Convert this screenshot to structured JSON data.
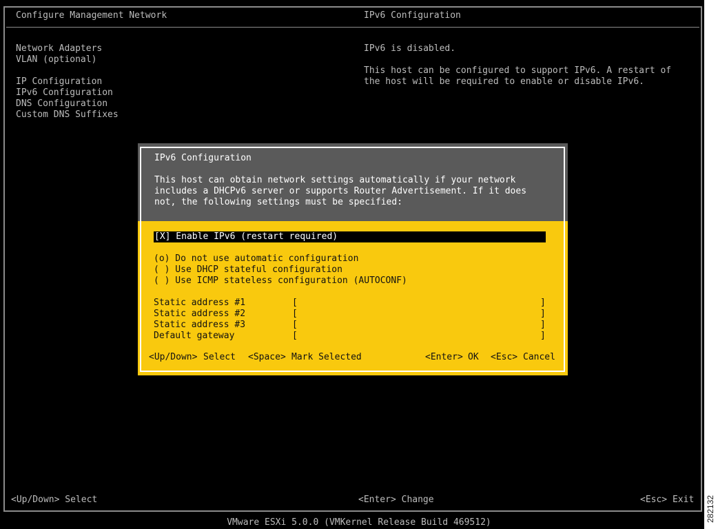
{
  "header": {
    "left_title": "Configure Management Network",
    "right_title": "IPv6 Configuration"
  },
  "menu": {
    "items": [
      "Network Adapters",
      "VLAN (optional)",
      "IP Configuration",
      "IPv6 Configuration",
      "DNS Configuration",
      "Custom DNS Suffixes"
    ]
  },
  "right_pane": {
    "status": "IPv6 is disabled.",
    "info": "This host can be configured to support IPv6. A restart of the host will be required to enable or disable IPv6."
  },
  "dialog": {
    "title": "IPv6 Configuration",
    "description": "This host can obtain network settings automatically if your network includes a DHCPv6 server or supports Router Advertisement. If it does not, the following settings must be specified:",
    "enable_checkbox": "[X] Enable IPv6 (restart required)",
    "options": [
      "(o) Do not use automatic configuration",
      "( ) Use DHCP stateful configuration",
      "( ) Use ICMP stateless configuration (AUTOCONF)"
    ],
    "fields": [
      {
        "label": "Static address #1",
        "open": "[",
        "value": "",
        "close": "]"
      },
      {
        "label": "Static address #2",
        "open": "[",
        "value": "",
        "close": "]"
      },
      {
        "label": "Static address #3",
        "open": "[",
        "value": "",
        "close": "]"
      },
      {
        "label": "Default gateway",
        "open": "[",
        "value": "",
        "close": "]"
      }
    ],
    "footer": {
      "updown_key": "<Up/Down>",
      "updown_action": "Select",
      "space_key": "<Space>",
      "space_action": "Mark Selected",
      "enter_key": "<Enter>",
      "enter_action": "OK",
      "esc_key": "<Esc>",
      "esc_action": "Cancel"
    }
  },
  "bottom_bar": {
    "left": "<Up/Down> Select",
    "center": "<Enter> Change",
    "right": "<Esc> Exit"
  },
  "status_line": "VMware ESXi 5.0.0 (VMKernel Release Build 469512)",
  "side_code": "282132",
  "colors": {
    "background": "#000000",
    "text": "#bdbdbd",
    "dialog_header_bg": "#5a5a5a",
    "dialog_body_bg": "#f9c90e",
    "highlight_bg": "#000000"
  }
}
